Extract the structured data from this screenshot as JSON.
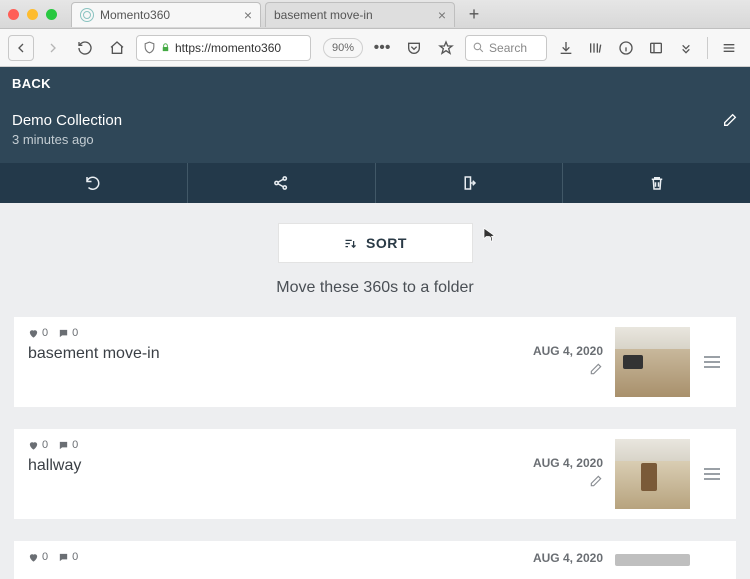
{
  "browser": {
    "tabs": [
      {
        "label": "Momento360",
        "active": true
      },
      {
        "label": "basement move-in",
        "active": false
      }
    ],
    "url_display": "https://momento360",
    "zoom": "90%",
    "search_placeholder": "Search"
  },
  "header": {
    "back": "BACK",
    "title": "Demo Collection",
    "subtitle": "3 minutes ago"
  },
  "sort_label": "SORT",
  "prompt": "Move these 360s to a folder",
  "items": [
    {
      "likes": "0",
      "comments": "0",
      "name": "basement move-in",
      "date": "AUG 4, 2020"
    },
    {
      "likes": "0",
      "comments": "0",
      "name": "hallway",
      "date": "AUG 4, 2020"
    },
    {
      "likes": "0",
      "comments": "0",
      "name": "",
      "date": "AUG 4, 2020"
    }
  ]
}
